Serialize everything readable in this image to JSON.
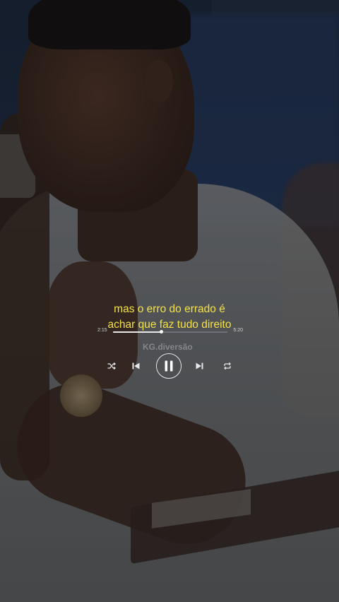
{
  "lyrics": {
    "line1": "mas o erro do errado é",
    "line2": "achar que faz tudo direito"
  },
  "player": {
    "current_time": "2:15",
    "total_time": "5:20",
    "progress": 0.42,
    "state": "playing",
    "accent_color": "#f3e14a"
  },
  "watermark": "KG.diversão",
  "icons": {
    "shuffle": "shuffle-icon",
    "previous": "skip-previous-icon",
    "pause": "pause-icon",
    "next": "skip-next-icon",
    "repeat": "repeat-icon"
  }
}
